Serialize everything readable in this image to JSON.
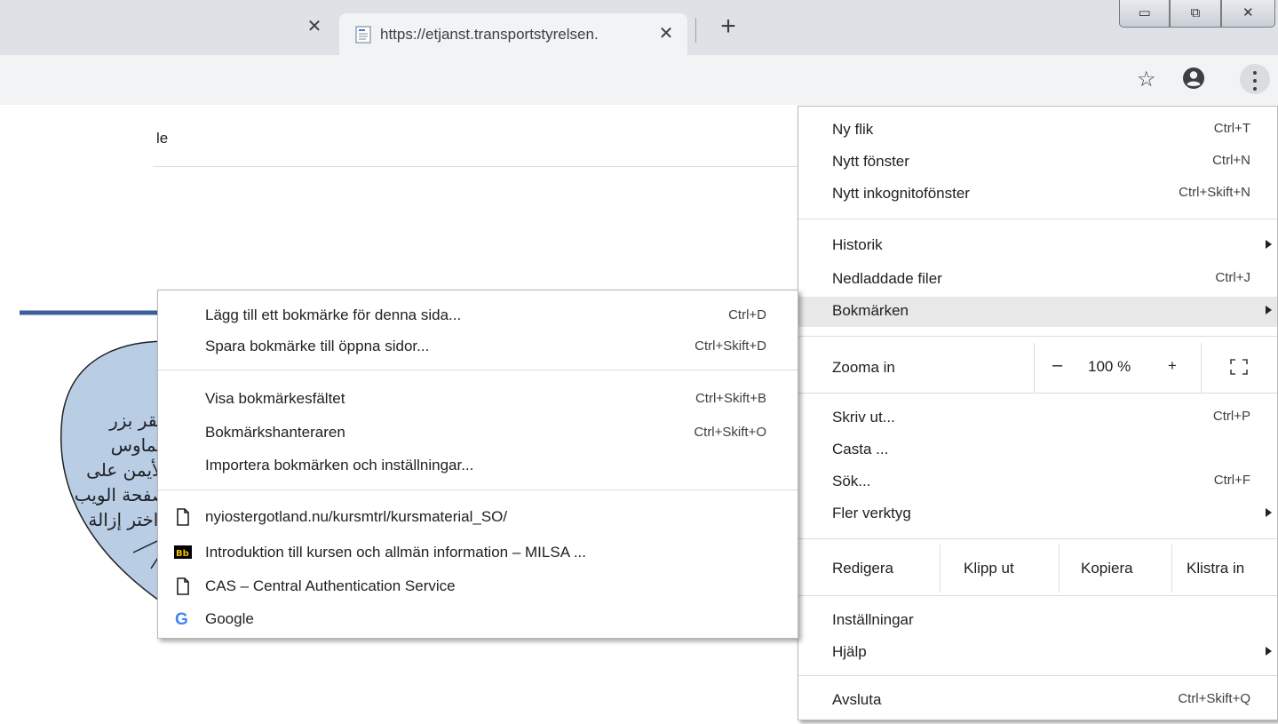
{
  "browser": {
    "prev_tab_close": "✕",
    "active_tab": {
      "title": "https://etjanst.transportstyrelsen.",
      "close": "✕"
    },
    "new_tab": "+",
    "window_controls": {
      "minimize": "▭",
      "maximize": "⧉",
      "close": "✕"
    },
    "toolbar": {
      "star_icon": "☆"
    }
  },
  "page": {
    "partial_text": "le"
  },
  "chrome_menu": {
    "items": [
      {
        "label": "Ny flik",
        "shortcut": "Ctrl+T"
      },
      {
        "label": "Nytt fönster",
        "shortcut": "Ctrl+N"
      },
      {
        "label": "Nytt inkognitofönster",
        "shortcut": "Ctrl+Skift+N"
      },
      {
        "label": "Historik",
        "shortcut": ""
      },
      {
        "label": "Nedladdade filer",
        "shortcut": "Ctrl+J"
      },
      {
        "label": "Bokmärken",
        "shortcut": ""
      },
      {
        "label": "Skriv ut...",
        "shortcut": "Ctrl+P"
      },
      {
        "label": "Casta ...",
        "shortcut": ""
      },
      {
        "label": "Sök...",
        "shortcut": "Ctrl+F"
      },
      {
        "label": "Fler verktyg",
        "shortcut": ""
      },
      {
        "label": "Inställningar",
        "shortcut": ""
      },
      {
        "label": "Hjälp",
        "shortcut": ""
      },
      {
        "label": "Avsluta",
        "shortcut": "Ctrl+Skift+Q"
      }
    ],
    "zoom": {
      "label": "Zooma in",
      "minus": "–",
      "value": "100 %",
      "plus": "+"
    },
    "edit": {
      "label": "Redigera",
      "cut": "Klipp ut",
      "copy": "Kopiera",
      "paste": "Klistra in"
    }
  },
  "bookmarks_submenu": {
    "items": [
      {
        "label": "Lägg till ett bokmärke för denna sida...",
        "shortcut": "Ctrl+D"
      },
      {
        "label": "Spara bokmärke till öppna sidor...",
        "shortcut": "Ctrl+Skift+D"
      },
      {
        "label": "Visa bokmärkesfältet",
        "shortcut": "Ctrl+Skift+B"
      },
      {
        "label": "Bokmärkshanteraren",
        "shortcut": "Ctrl+Skift+O"
      },
      {
        "label": "Importera bokmärken och inställningar...",
        "shortcut": ""
      }
    ],
    "bookmarks": [
      {
        "label": "nyiostergotland.nu/kursmtrl/kursmaterial_SO/",
        "icon": "page-icon"
      },
      {
        "label": "Introduktion till kursen och allmän information – MILSA ...",
        "icon": "blackboard-icon",
        "icon_text": "Bb"
      },
      {
        "label": "CAS – Central Authentication Service",
        "icon": "page-icon"
      },
      {
        "label": "Google",
        "icon": "google-icon",
        "icon_text": "G"
      }
    ]
  },
  "callout": {
    "lines": [
      "انقر بزر",
      "الماوس",
      "الأيمن على",
      "صفحة الويب",
      "واختر إزالة"
    ],
    "colors": {
      "fill": "#b9cde5",
      "arrow": "#3a5f9b"
    }
  }
}
